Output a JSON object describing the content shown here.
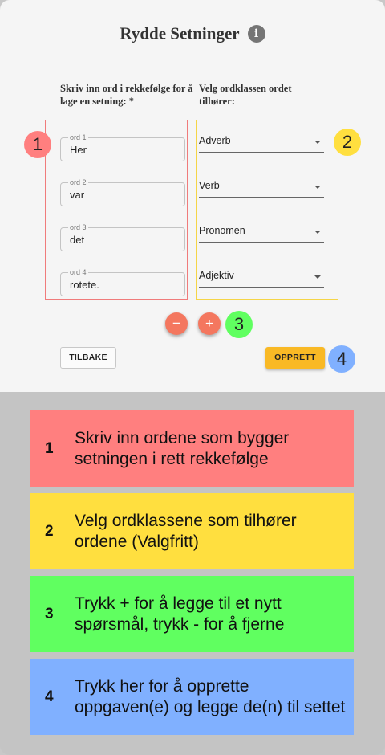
{
  "header": {
    "title": "Rydde Setninger",
    "info_icon": "i"
  },
  "columns": {
    "words_heading": "Skriv inn ord i rekkefølge for å lage en setning: *",
    "classes_heading": "Velg ordklassen ordet tilhører:"
  },
  "words": [
    {
      "label": "ord 1",
      "value": "Her"
    },
    {
      "label": "ord 2",
      "value": "var"
    },
    {
      "label": "ord 3",
      "value": "det"
    },
    {
      "label": "ord 4",
      "value": "rotete."
    }
  ],
  "classes": [
    {
      "value": "Adverb"
    },
    {
      "value": "Verb"
    },
    {
      "value": "Pronomen"
    },
    {
      "value": "Adjektiv"
    }
  ],
  "controls": {
    "remove_label": "−",
    "add_label": "+"
  },
  "buttons": {
    "back_label": "TILBAKE",
    "create_label": "OPPRETT"
  },
  "badges": [
    "1",
    "2",
    "3",
    "4"
  ],
  "colors": {
    "red": "#ff7f7f",
    "yellow": "#ffdf3f",
    "green": "#60ff60",
    "blue": "#80b0ff",
    "create_button": "#f9b925",
    "round_button": "#f4775f"
  },
  "legend": [
    {
      "number": "1",
      "text": "Skriv inn ordene som bygger setningen i rett rekkefølge"
    },
    {
      "number": "2",
      "text": "Velg ordklassene som tilhører ordene (Valgfritt)"
    },
    {
      "number": "3",
      "text": "Trykk + for å legge til et nytt spørsmål, trykk - for å fjerne"
    },
    {
      "number": "4",
      "text": "Trykk her for å opprette oppgaven(e) og legge de(n) til settet"
    }
  ]
}
